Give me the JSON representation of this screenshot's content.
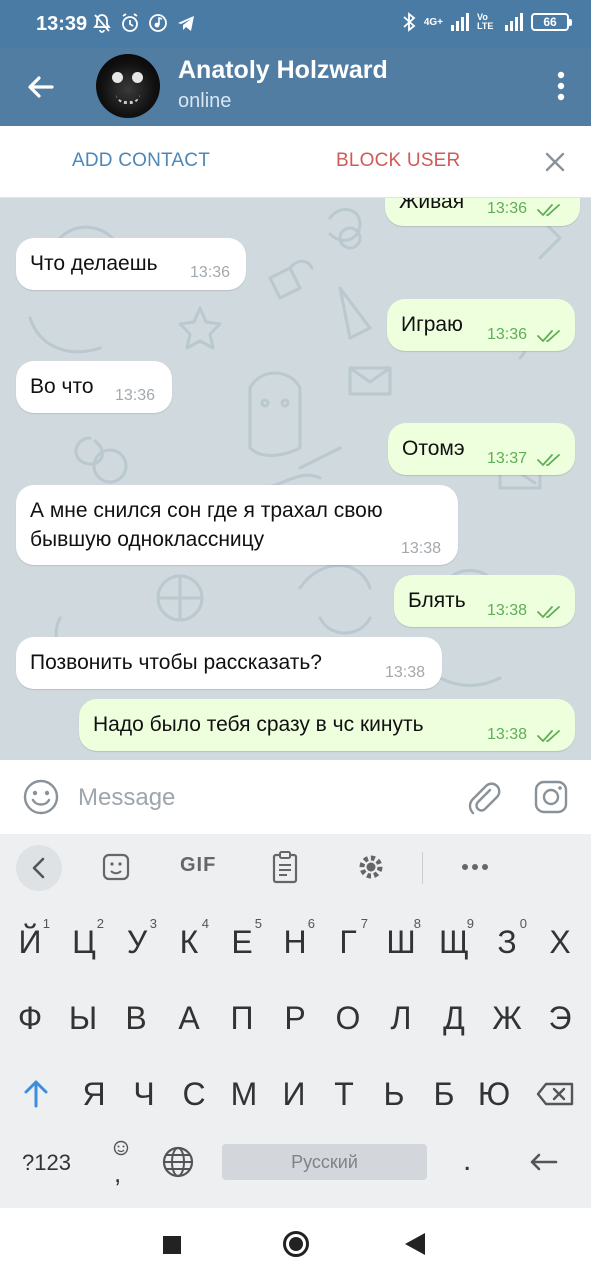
{
  "status_bar": {
    "time": "13:39",
    "network_label": "4G+",
    "volte_label": "Vo LTE",
    "battery": "66"
  },
  "header": {
    "name": "Anatoly Holzward",
    "status": "online"
  },
  "action_bar": {
    "add_contact": "ADD CONTACT",
    "block_user": "BLOCK USER"
  },
  "messages": [
    {
      "dir": "out",
      "text": "Живая",
      "time": "13:36",
      "read": true
    },
    {
      "dir": "in",
      "text": "Что делаешь",
      "time": "13:36"
    },
    {
      "dir": "out",
      "text": "Играю",
      "time": "13:36",
      "read": true
    },
    {
      "dir": "in",
      "text": "Во что",
      "time": "13:36"
    },
    {
      "dir": "out",
      "text": "Отомэ",
      "time": "13:37",
      "read": true
    },
    {
      "dir": "in",
      "text_line1": "А мне снился сон где я трахал свою",
      "text_line2": "бывшую одноклассницу",
      "time": "13:38"
    },
    {
      "dir": "out",
      "text": "Блять",
      "time": "13:38",
      "read": true
    },
    {
      "dir": "in",
      "text": "Позвонить чтобы рассказать?",
      "time": "13:38"
    },
    {
      "dir": "out",
      "text": "Надо было тебя сразу в чс кинуть",
      "time": "13:38",
      "read": true
    }
  ],
  "composer": {
    "placeholder": "Message",
    "value": ""
  },
  "keyboard": {
    "gif_label": "GIF",
    "row1": [
      "Й",
      "Ц",
      "У",
      "К",
      "Е",
      "Н",
      "Г",
      "Ш",
      "Щ",
      "З",
      "Х"
    ],
    "row1_hints": [
      "1",
      "2",
      "3",
      "4",
      "5",
      "6",
      "7",
      "8",
      "9",
      "0",
      ""
    ],
    "row2": [
      "Ф",
      "Ы",
      "В",
      "А",
      "П",
      "Р",
      "О",
      "Л",
      "Д",
      "Ж",
      "Э"
    ],
    "row3": [
      "Я",
      "Ч",
      "С",
      "М",
      "И",
      "Т",
      "Ь",
      "Б",
      "Ю"
    ],
    "numbers_key": "?123",
    "comma_key": ",",
    "space_label": "Русский",
    "period_key": "."
  },
  "colors": {
    "header": "#517da2",
    "incoming_bubble": "#ffffff",
    "outgoing_bubble": "#eeffde",
    "outgoing_time": "#5fae57",
    "add_contact": "#4b87b8",
    "block_user": "#cf5a57",
    "chat_background": "#cfd9de"
  }
}
